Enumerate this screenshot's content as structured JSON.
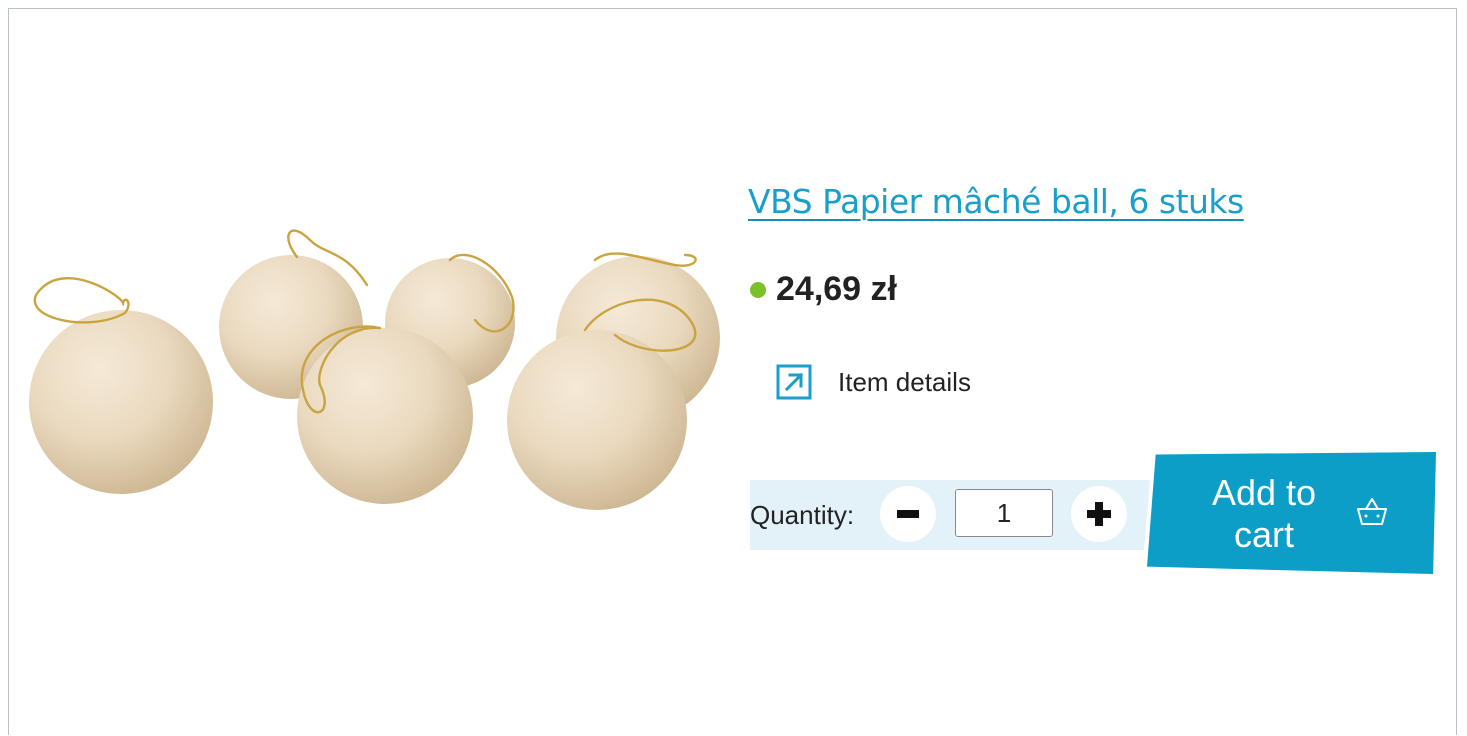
{
  "product": {
    "title": "VBS Papier mâché ball, 6 stuks",
    "price": "24,69 zł",
    "details_label": "Item details",
    "quantity_label": "Quantity:",
    "quantity_value": "1",
    "add_to_cart_label": "Add to cart",
    "image_subject": "papier-mache-balls"
  },
  "icons": {
    "stock": "stock-dot-icon",
    "details": "external-link-icon",
    "minus": "minus-icon",
    "plus": "plus-icon",
    "cart": "basket-icon"
  },
  "colors": {
    "accent": "#1a9fcb",
    "cart_button": "#0d9ec7",
    "stock_green": "#7cc02c",
    "quantity_band": "#e2f2f8",
    "text": "#222222"
  }
}
